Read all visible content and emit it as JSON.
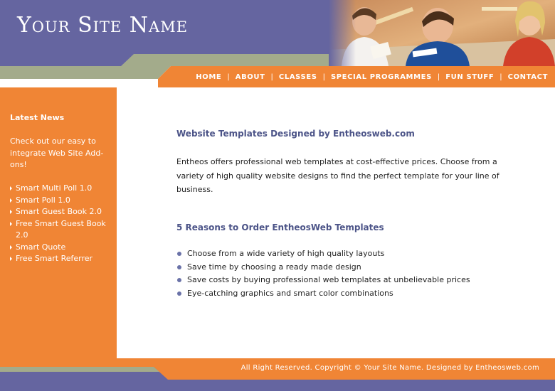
{
  "header": {
    "site_name": "Your Site Name",
    "photo_alt": "children studying photo"
  },
  "nav": {
    "items": [
      "HOME",
      "ABOUT",
      "CLASSES",
      "SPECIAL PROGRAMMES",
      "FUN STUFF",
      "CONTACT"
    ],
    "separator": "|"
  },
  "sidebar": {
    "title": "Latest News",
    "intro": "Check out our easy to integrate Web Site Add-ons!",
    "links": [
      "Smart Multi Poll 1.0",
      "Smart Poll 1.0",
      "Smart Guest Book 2.0",
      "Free Smart Guest Book 2.0",
      "Smart Quote",
      "Free Smart Referrer"
    ]
  },
  "main": {
    "heading1": "Website Templates Designed by Entheosweb.com",
    "paragraph": "Entheos offers professional web templates at cost-effective prices. Choose from a variety of high quality website designs to find the perfect template for your line of business.",
    "heading2": "5 Reasons to Order EntheosWeb Templates",
    "reasons": [
      "Choose from a wide variety of high quality layouts",
      "Save time by choosing a ready made design",
      "Save costs by buying professional web templates at unbelievable prices",
      "Eye-catching graphics and smart color combinations"
    ]
  },
  "footer": {
    "copyright": "All Right Reserved. Copyright © Your Site Name. Designed by Entheosweb.com"
  },
  "colors": {
    "purple": "#6565a0",
    "orange": "#f08535",
    "sage": "#a3ab8b",
    "heading": "#4c5488"
  }
}
